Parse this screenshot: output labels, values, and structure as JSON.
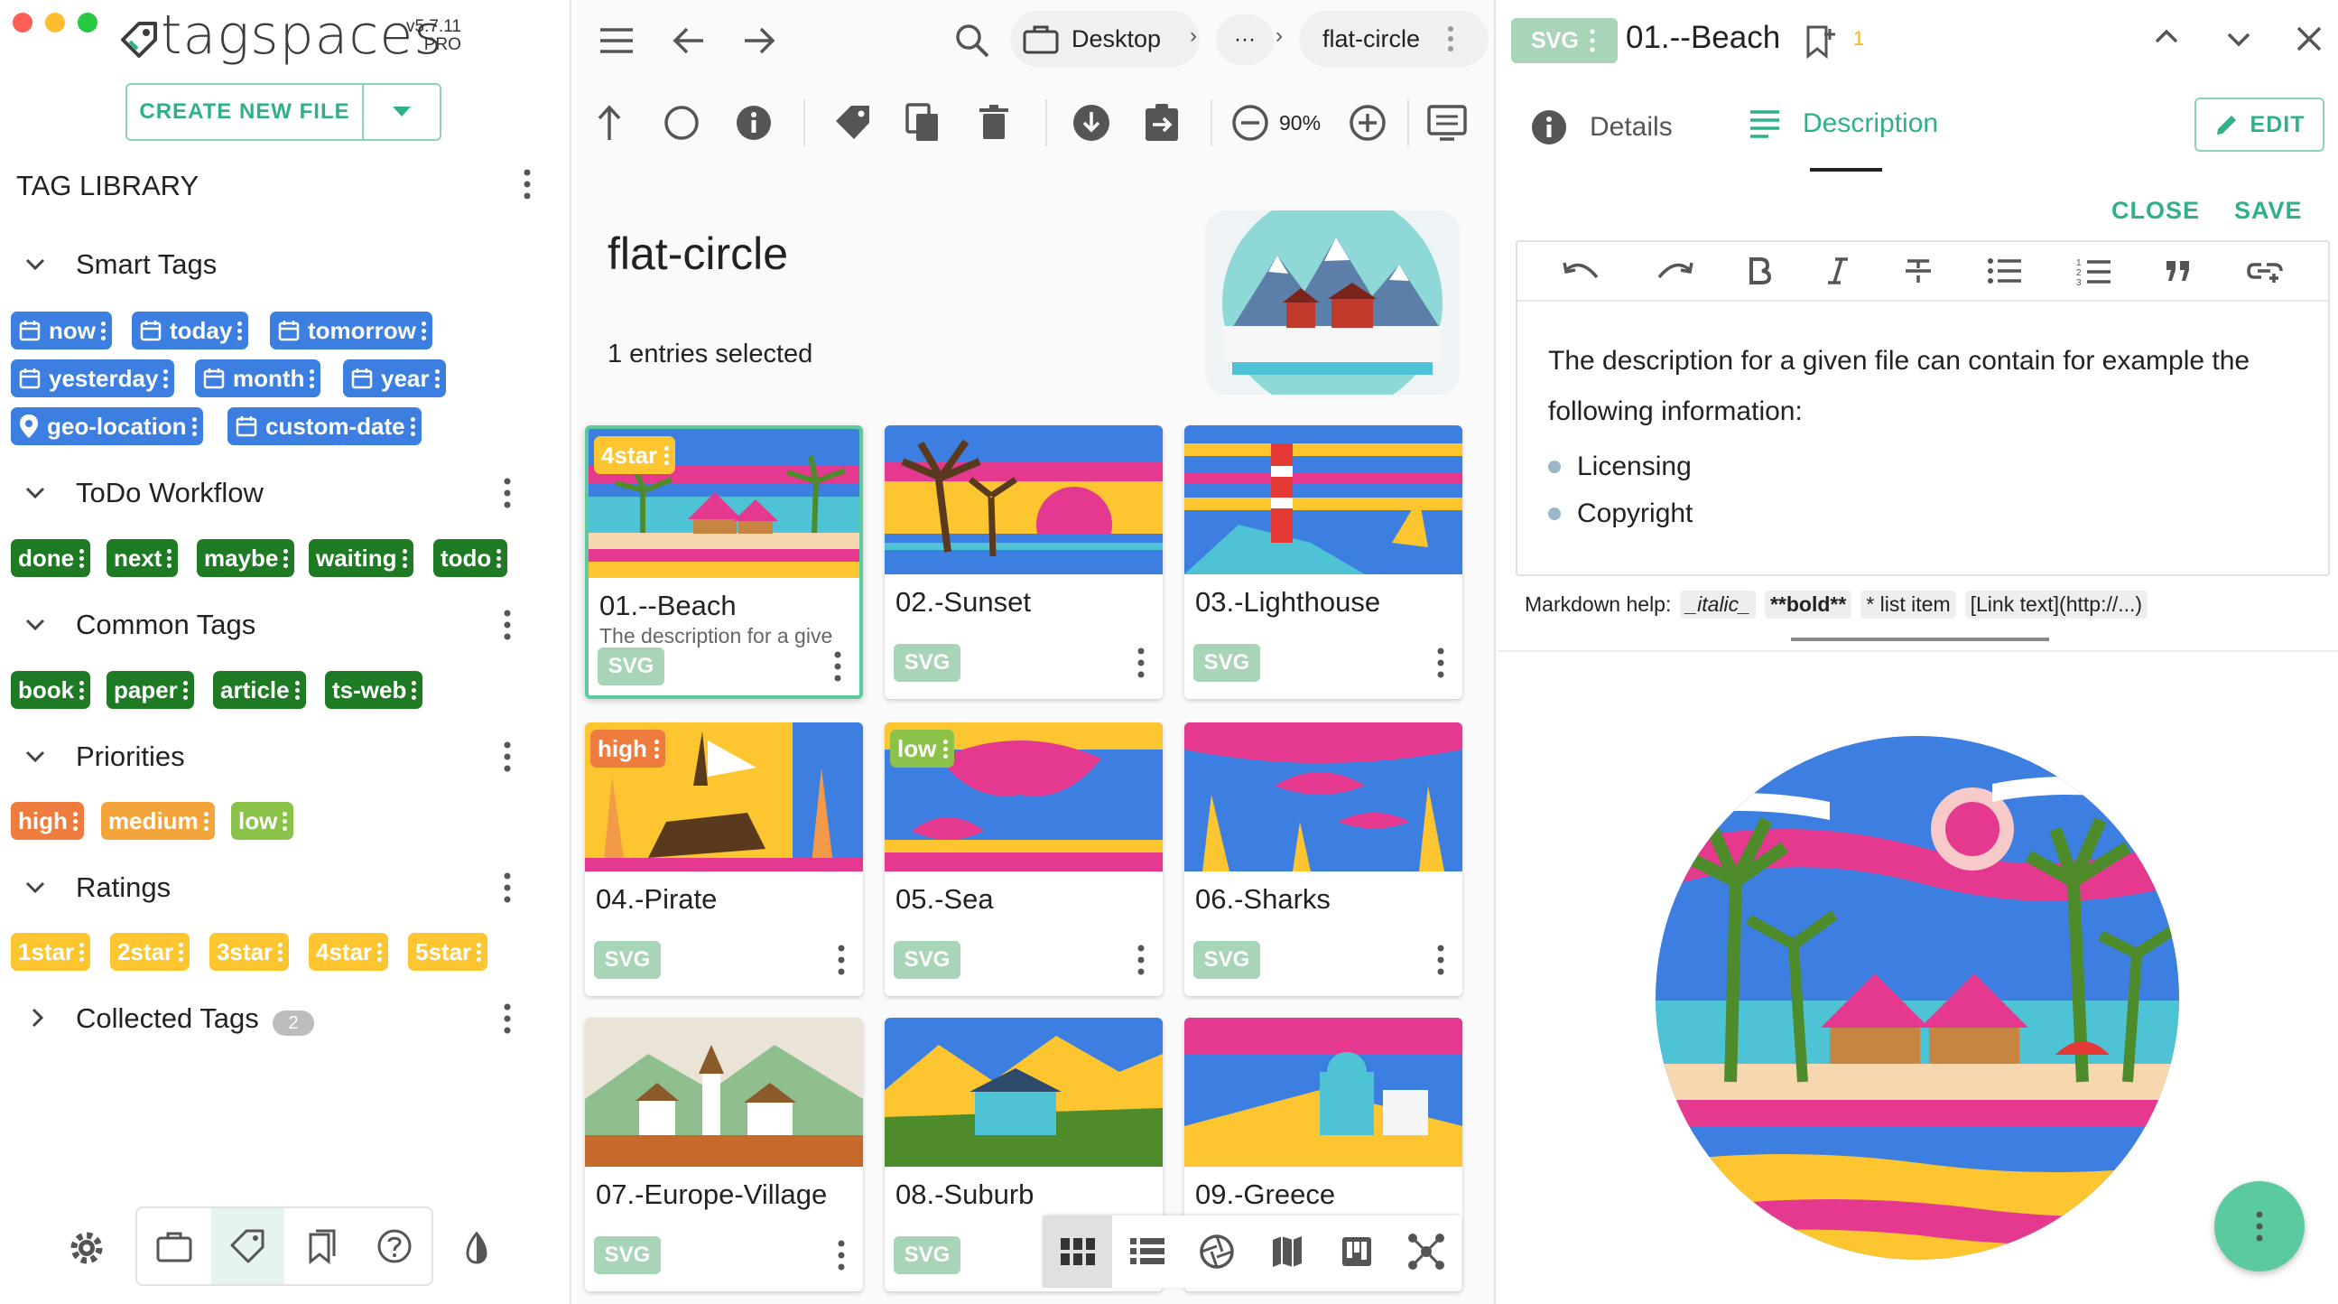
{
  "app": {
    "logo": "tagspaces",
    "version": "v5.7.11",
    "edition": "PRO",
    "create_label": "CREATE NEW FILE"
  },
  "library": {
    "title": "TAG LIBRARY",
    "groups": [
      {
        "name": "Smart Tags",
        "tags": [
          "now",
          "today",
          "tomorrow",
          "yesterday",
          "month",
          "year",
          "geo-location",
          "custom-date"
        ]
      },
      {
        "name": "ToDo Workflow",
        "tags": [
          "done",
          "next",
          "maybe",
          "waiting",
          "todo"
        ]
      },
      {
        "name": "Common Tags",
        "tags": [
          "book",
          "paper",
          "article",
          "ts-web"
        ]
      },
      {
        "name": "Priorities",
        "tags": [
          "high",
          "medium",
          "low"
        ]
      },
      {
        "name": "Ratings",
        "tags": [
          "1star",
          "2star",
          "3star",
          "4star",
          "5star"
        ]
      },
      {
        "name": "Collected Tags",
        "count": "2"
      }
    ]
  },
  "toolbar": {
    "location": "Desktop",
    "ellipsis": "···",
    "current_folder": "flat-circle",
    "zoom": "90%"
  },
  "folder": {
    "title": "flat-circle",
    "selection": "1 entries selected"
  },
  "files": [
    {
      "name": "01.--Beach",
      "ext": "SVG",
      "tag": "4star",
      "desc": "The description for a give"
    },
    {
      "name": "02.-Sunset",
      "ext": "SVG"
    },
    {
      "name": "03.-Lighthouse",
      "ext": "SVG"
    },
    {
      "name": "04.-Pirate",
      "ext": "SVG",
      "tag": "high"
    },
    {
      "name": "05.-Sea",
      "ext": "SVG",
      "tag": "low"
    },
    {
      "name": "06.-Sharks",
      "ext": "SVG"
    },
    {
      "name": "07.-Europe-Village",
      "ext": "SVG"
    },
    {
      "name": "08.-Suburb",
      "ext": "SVG"
    },
    {
      "name": "09.-Greece",
      "ext": "SVG"
    }
  ],
  "properties": {
    "ext": "SVG",
    "title": "01.--Beach",
    "revision": "1",
    "tabs": [
      "Details",
      "Description"
    ],
    "edit_label": "EDIT",
    "close_label": "CLOSE",
    "save_label": "SAVE",
    "description_text": "The description for a given file can contain for example the following information:",
    "description_items": [
      "Licensing",
      "Copyright"
    ],
    "md_help": {
      "label": "Markdown help:",
      "italic": "_italic_",
      "bold": "**bold**",
      "list": "* list item",
      "link": "[Link text](http://...)"
    }
  },
  "colors": {
    "accent": "#2fb08a",
    "accent_light": "#8fd1b3",
    "smart_tag": "#3d7fe0",
    "workflow_tag": "#1f7a24",
    "high": "#ef7c3f",
    "medium": "#f3a53b",
    "low": "#8bc34a",
    "rating": "#fdc530",
    "ext_badge": "#a8d4b8"
  }
}
